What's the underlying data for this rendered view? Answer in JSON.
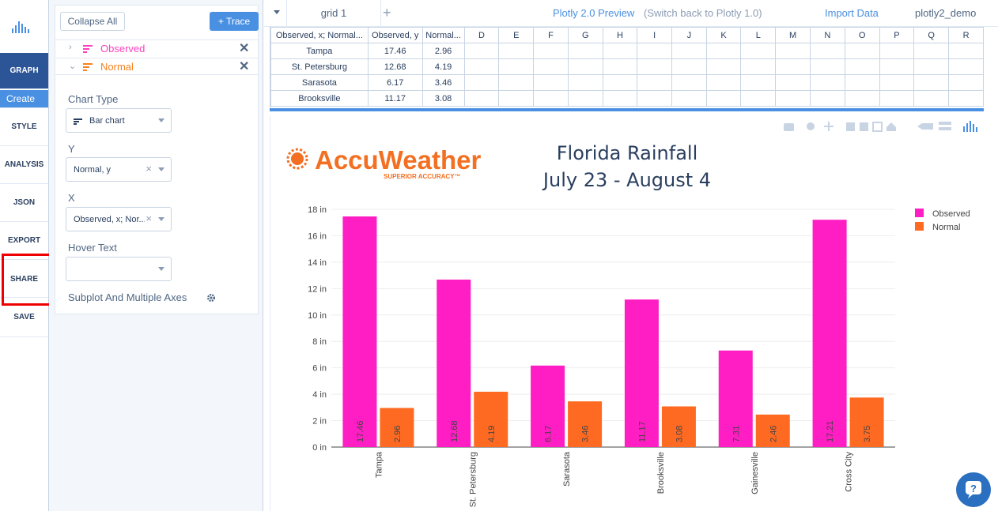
{
  "nav": {
    "items": [
      "GRAPH",
      "Create",
      "STYLE",
      "ANALYSIS",
      "JSON",
      "EXPORT",
      "SHARE",
      "SAVE"
    ]
  },
  "panel": {
    "collapse_all": "Collapse All",
    "add_trace": "+ Trace",
    "traces": [
      {
        "name": "Observed",
        "color": "#ff3fbf"
      },
      {
        "name": "Normal",
        "color": "#f58220"
      }
    ],
    "chart_type_label": "Chart Type",
    "chart_type_value": "Bar chart",
    "y_label": "Y",
    "y_value": "Normal, y",
    "x_label": "X",
    "x_value": "Observed, x; Nor...",
    "hover_label": "Hover Text",
    "hover_value": "",
    "subplot_label": "Subplot And Multiple Axes"
  },
  "topbar": {
    "grid_name": "grid 1",
    "preview": "Plotly 2.0 Preview",
    "switch_back": "(Switch back to Plotly 1.0)",
    "import_data": "Import Data",
    "user": "plotly2_demo"
  },
  "grid": {
    "headers": [
      "Observed, x; Normal...",
      "Observed, y",
      "Normal...",
      "D",
      "E",
      "F",
      "G",
      "H",
      "I",
      "J",
      "K",
      "L",
      "M",
      "N",
      "O",
      "P",
      "Q",
      "R"
    ],
    "rows": [
      [
        "Tampa",
        "17.46",
        "2.96"
      ],
      [
        "St. Petersburg",
        "12.68",
        "4.19"
      ],
      [
        "Sarasota",
        "6.17",
        "3.46"
      ],
      [
        "Brooksville",
        "11.17",
        "3.08"
      ]
    ]
  },
  "logo": {
    "name": "AccuWeather",
    "tagline": "SUPERIOR ACCURACY™"
  },
  "colors": {
    "observed": "#ff1dc4",
    "normal": "#ff6a22",
    "accent": "#4a90e2",
    "nav_dark": "#2b5597"
  },
  "chart_data": {
    "type": "bar",
    "title": "Florida Rainfall",
    "subtitle": "July 23 - August 4",
    "categories": [
      "Tampa",
      "St. Petersburg",
      "Sarasota",
      "Brooksville",
      "Gainesville",
      "Cross City"
    ],
    "series": [
      {
        "name": "Observed",
        "values": [
          17.46,
          12.68,
          6.17,
          11.17,
          7.31,
          17.21
        ]
      },
      {
        "name": "Normal",
        "values": [
          2.96,
          4.19,
          3.46,
          3.08,
          2.46,
          3.75
        ]
      }
    ],
    "ylim": [
      0,
      18
    ],
    "yticks": [
      "0 in",
      "2 in",
      "4 in",
      "6 in",
      "8 in",
      "10 in",
      "12 in",
      "14 in",
      "16 in",
      "18 in"
    ],
    "legend": "top-right",
    "grid": true
  }
}
